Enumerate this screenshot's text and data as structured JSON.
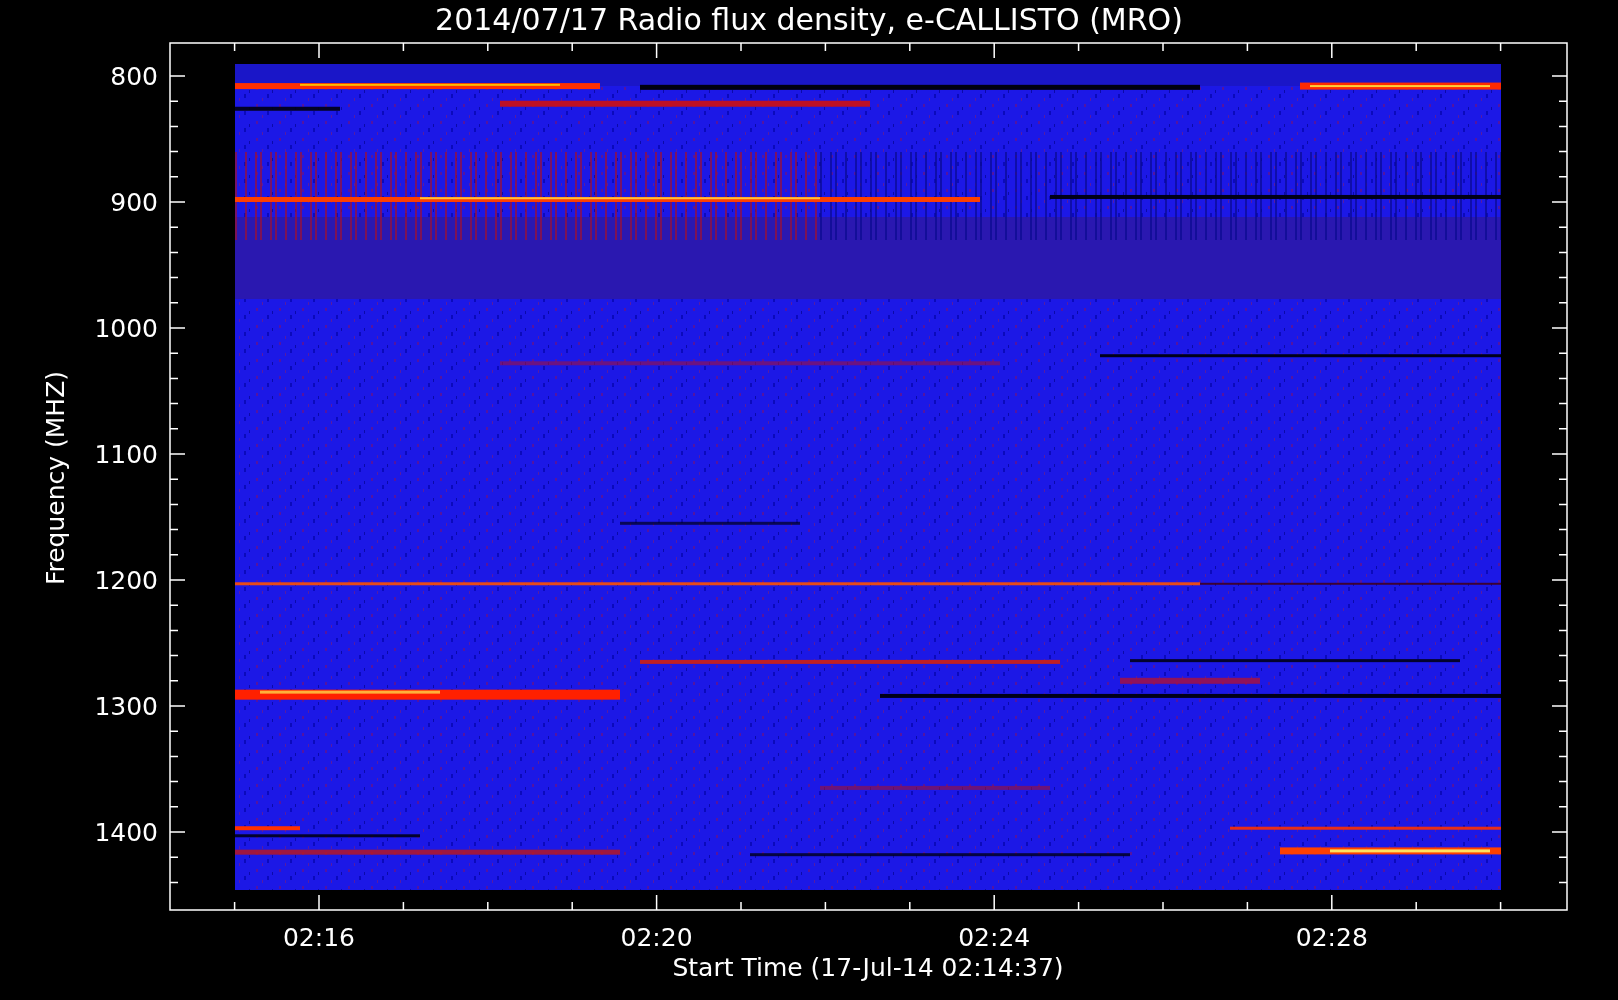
{
  "title": "2014/07/17  Radio flux density, e-CALLISTO (MRO)",
  "y_axis": {
    "label": "Frequency (MHZ)",
    "ticks": [
      "800",
      "900",
      "1000",
      "1100",
      "1200",
      "1300",
      "1400"
    ]
  },
  "x_axis": {
    "label": "Start Time (17-Jul-14 02:14:37)",
    "ticks": [
      "02:16",
      "02:20",
      "02:24",
      "02:28"
    ]
  }
}
